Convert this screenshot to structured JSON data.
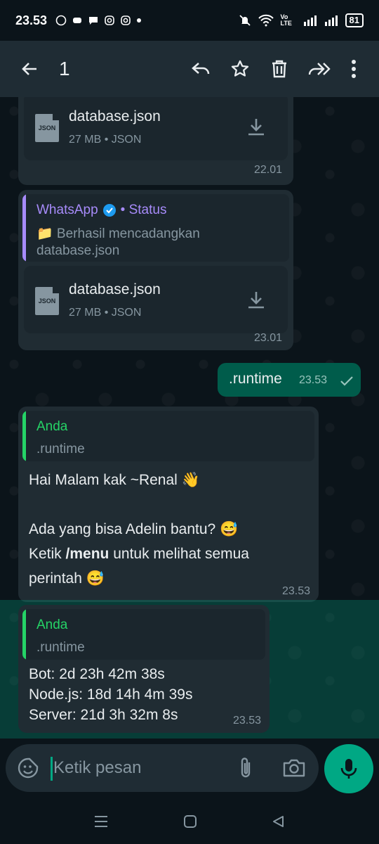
{
  "status_bar": {
    "time": "23.53",
    "network_label": "Vo LTE",
    "battery": "81"
  },
  "app_bar": {
    "selected_count": "1"
  },
  "messages": {
    "m1": {
      "file_name": "database.json",
      "file_meta": "27 MB • JSON",
      "time": "22.01"
    },
    "m2": {
      "quote_author": "WhatsApp",
      "quote_author_suffix": "• Status",
      "quote_line1": "📁 Berhasil mencadangkan",
      "quote_line2": "database.json",
      "file_name": "database.json",
      "file_meta": "27 MB • JSON",
      "time": "23.01"
    },
    "m3": {
      "text": ".runtime",
      "time": "23.53"
    },
    "m4": {
      "quote_author": "Anda",
      "quote_text": ".runtime",
      "line1": "Hai Malam kak ~Renal 👋",
      "line2": "Ada yang bisa Adelin bantu? 😅",
      "line3_prefix": "Ketik ",
      "line3_bold": "/menu",
      "line3_suffix": " untuk melihat semua",
      "line4": "perintah 😅",
      "time": "23.53"
    },
    "m5": {
      "quote_author": "Anda",
      "quote_text": ".runtime",
      "line1": "Bot: 2d 23h 42m 38s",
      "line2": "Node.js: 18d 14h 4m 39s",
      "line3": "Server: 21d 3h 32m 8s",
      "time": "23.53"
    }
  },
  "composer": {
    "placeholder": "Ketik pesan"
  },
  "colors": {
    "accent": "#00a884",
    "quote_purple": "#a78bfa",
    "quote_green": "#25d366"
  },
  "icons": [
    "back-arrow-icon",
    "reply-icon",
    "star-icon",
    "trash-icon",
    "forward-icon",
    "more-vert-icon",
    "download-icon",
    "verified-icon",
    "check-icon",
    "sticker-icon",
    "attach-icon",
    "camera-icon",
    "mic-icon"
  ]
}
